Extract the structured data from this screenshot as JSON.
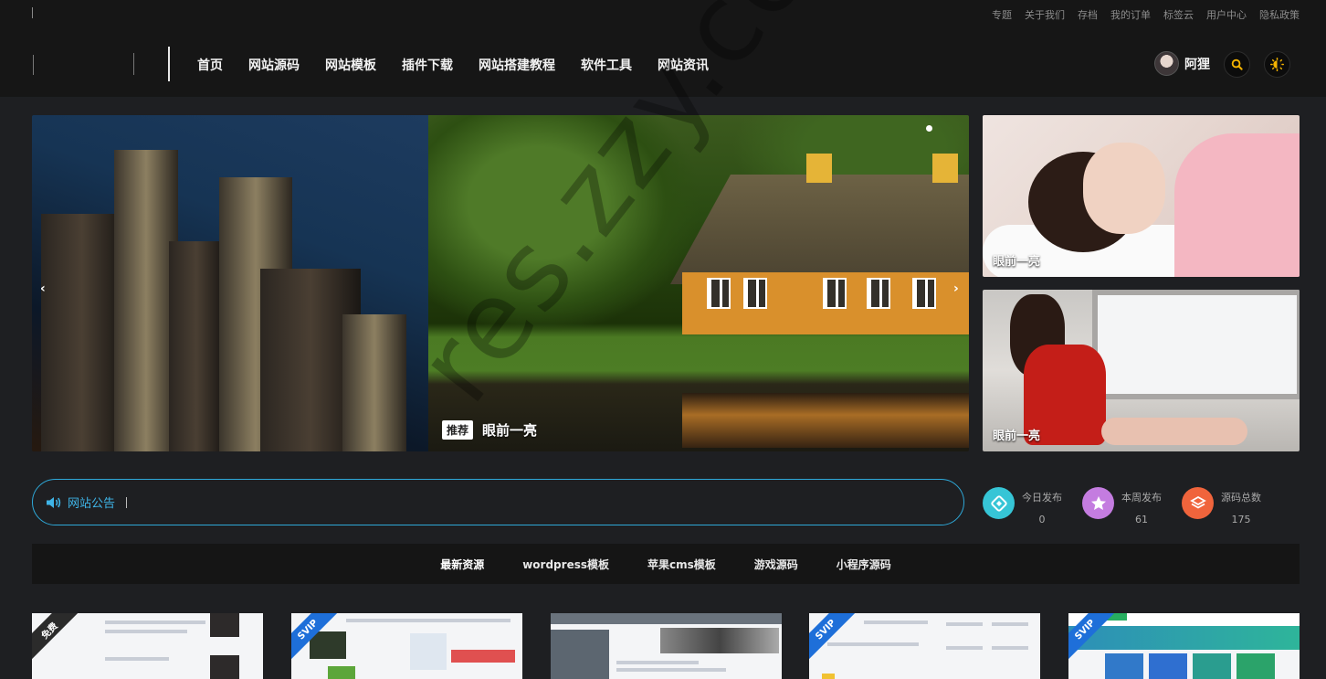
{
  "top_links": [
    "专题",
    "关于我们",
    "存档",
    "我的订单",
    "标签云",
    "用户中心",
    "隐私政策"
  ],
  "main_nav": [
    "首页",
    "网站源码",
    "网站模板",
    "插件下载",
    "网站搭建教程",
    "软件工具",
    "网站资讯"
  ],
  "user": {
    "name": "阿狸"
  },
  "icons": {
    "search": "search-icon",
    "theme": "theme-toggle-icon",
    "speaker": "speaker-icon"
  },
  "slider": {
    "tag": "推荐",
    "caption": "眼前一亮",
    "prev": "‹",
    "next": "›"
  },
  "side_cards": [
    {
      "caption": "眼前一亮"
    },
    {
      "caption": "眼前一亮"
    }
  ],
  "notice": {
    "label": "网站公告"
  },
  "stats": [
    {
      "label": "今日发布",
      "value": "0",
      "color": "#36c5d6"
    },
    {
      "label": "本周发布",
      "value": "61",
      "color": "#c47ce0"
    },
    {
      "label": "源码总数",
      "value": "175",
      "color": "#f0643c"
    }
  ],
  "tabs": [
    "最新资源",
    "wordpress模板",
    "苹果cms模板",
    "游戏源码",
    "小程序源码"
  ],
  "cards": [
    {
      "badge": "免费",
      "badge_color": "#2b2b2b"
    },
    {
      "badge": "SVIP",
      "badge_color": "#1e6fd9"
    },
    {
      "badge": "",
      "badge_color": ""
    },
    {
      "badge": "SVIP",
      "badge_color": "#1e6fd9"
    },
    {
      "badge": "SVIP",
      "badge_color": "#1e6fd9"
    }
  ],
  "watermark": "res.zzy.com",
  "accent_color": "#2ea8d8"
}
